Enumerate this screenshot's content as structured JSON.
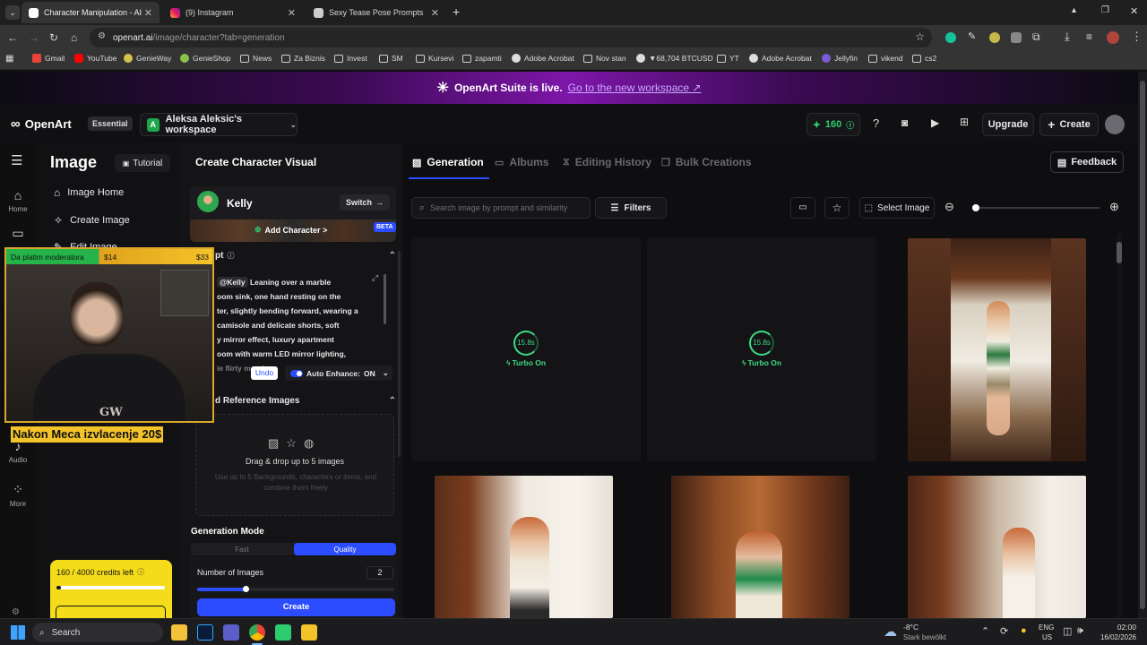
{
  "browser": {
    "tabs": [
      {
        "title": "Character Manipulation - AI Im",
        "active": true
      },
      {
        "title": "(9) Instagram",
        "active": false
      },
      {
        "title": "Sexy Tease Pose Prompts",
        "active": false
      }
    ],
    "url_host": "openart.ai",
    "url_path": "/image/character?tab=generation",
    "bookmarks": [
      "Gmail",
      "YouTube",
      "GenieWay",
      "GenieShop",
      "News",
      "Za Biznis",
      "Invest",
      "SM",
      "Kursevi",
      "zapamti",
      "Adobe Acrobat",
      "Nov stan",
      "▼68,704 BTCUSD",
      "YT",
      "Adobe Acrobat",
      "Jellyfin",
      "vikend",
      "cs2"
    ]
  },
  "banner": {
    "text": "OpenArt Suite is live.",
    "link": "Go to the new workspace ↗"
  },
  "header": {
    "brand": "OpenArt",
    "plan_badge": "Essential",
    "workspace_initial": "A",
    "workspace": "Aleksa Aleksic's workspace",
    "credits": "160",
    "upgrade": "Upgrade",
    "create": "Create"
  },
  "rail": {
    "home": "Home",
    "audio": "Audio",
    "more": "More"
  },
  "leftmenu": {
    "title": "Image",
    "tutorial": "Tutorial",
    "items": [
      "Image Home",
      "Create Image",
      "Edit Image"
    ],
    "credits_text": "160 / 4000 credits left",
    "credits_fraction": 0.04
  },
  "midpanel": {
    "title": "Create Character Visual",
    "character_name": "Kelly",
    "switch": "Switch",
    "add_character": "Add Character >",
    "beta": "BETA",
    "prompt_label": "pt",
    "prompt_mention": "@Kelly",
    "prompt_lines": [
      "Leaning over a marble",
      "oom sink, one hand resting on the",
      "ter, slightly bending forward, wearing a",
      "camisole and delicate shorts, soft",
      "y mirror effect, luxury apartment",
      "oom with warm LED mirror lighting,",
      "ie flirty mood"
    ],
    "undo": "Undo",
    "auto_enhance": "Auto Enhance:",
    "auto_enhance_state": "ON",
    "reference_label": "d Reference Images",
    "drop_title": "Drag & drop up to 5 images",
    "drop_sub": "Use up to 5 Backgrounds, characters or items, and combine them freely",
    "generation_mode": "Generation Mode",
    "mode_fast": "Fast",
    "mode_quality": "Quality",
    "num_images_label": "Number of Images",
    "num_images": "2",
    "num_images_slider_fraction": 0.25,
    "create": "Create"
  },
  "content": {
    "tabs": [
      "Generation",
      "Albums",
      "Editing History",
      "Bulk Creations"
    ],
    "feedback": "Feedback",
    "search_placeholder": "Search image by prompt and similarity",
    "filters": "Filters",
    "select_image": "Select Image",
    "zoom_fraction": 0.03,
    "pending": [
      {
        "time": "15.8s",
        "status": "Turbo On"
      },
      {
        "time": "15.8s",
        "status": "Turbo On"
      }
    ]
  },
  "webcam": {
    "top_label": "Da platim moderatora",
    "amount1": "$14",
    "amount2": "$33",
    "bottom_text": "Nakon Meca izvlacenje 20$",
    "logo_text": "GW"
  },
  "taskbar": {
    "search": "Search",
    "weather_temp": "-8°C",
    "weather_desc": "Stark bewölkt",
    "lang1": "ENG",
    "lang2": "US",
    "time": "02:00",
    "date": "16/02/2026"
  },
  "colors": {
    "accent_blue": "#2b4cff",
    "credit_green": "#2ecc71",
    "turbo_green": "#3ddc84",
    "banner_purple": "#7d16a8",
    "yellow": "#f4dc1a"
  }
}
